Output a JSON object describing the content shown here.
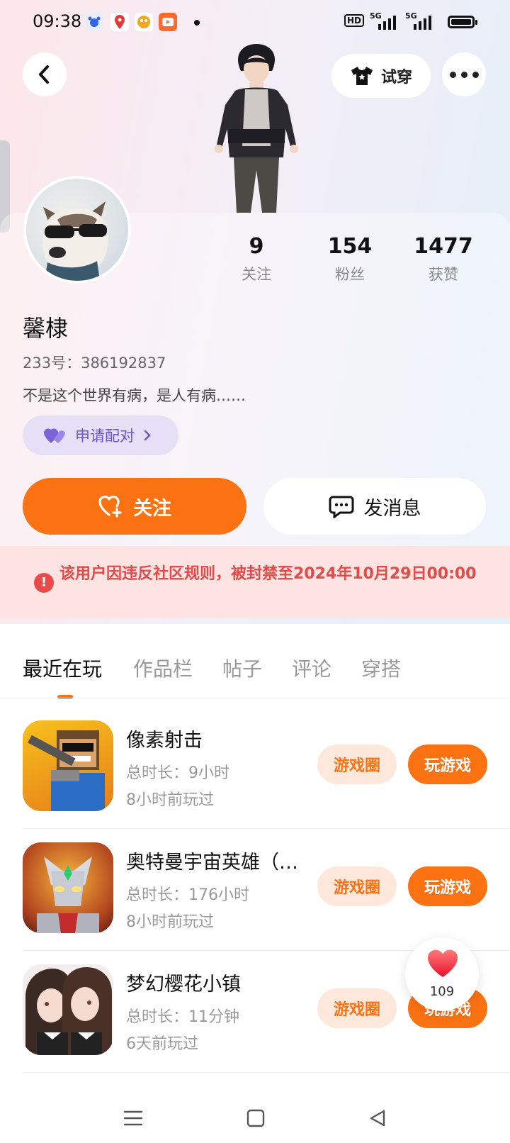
{
  "status_bar": {
    "time": "09:38",
    "hd_label": "HD",
    "sig1_label": "5G",
    "sig2_label": "5G"
  },
  "header": {
    "tryon_label": "试穿"
  },
  "profile": {
    "name": "馨棣",
    "uid": "233号：386192837",
    "bio": "不是这个世界有病，是人有病……",
    "match_label": "申请配对",
    "stats": [
      {
        "value": "9",
        "label": "关注"
      },
      {
        "value": "154",
        "label": "粉丝"
      },
      {
        "value": "1477",
        "label": "获赞"
      }
    ]
  },
  "actions": {
    "follow_label": "关注",
    "message_label": "发消息"
  },
  "ban_notice": "该用户因违反社区规则，被封禁至2024年10月29日00:00",
  "tabs": [
    {
      "label": "最近在玩",
      "active": true
    },
    {
      "label": "作品栏",
      "active": false
    },
    {
      "label": "帖子",
      "active": false
    },
    {
      "label": "评论",
      "active": false
    },
    {
      "label": "穿搭",
      "active": false
    }
  ],
  "games": [
    {
      "title": "像素射击",
      "duration": "总时长：9小时",
      "last_played": "8小时前玩过",
      "circle_label": "游戏圈",
      "play_label": "玩游戏",
      "icon": "pixel-shooter-icon"
    },
    {
      "title": "奥特曼宇宙英雄（…",
      "duration": "总时长：176小时",
      "last_played": "8小时前玩过",
      "circle_label": "游戏圈",
      "play_label": "玩游戏",
      "icon": "ultraman-icon"
    },
    {
      "title": "梦幻樱花小镇",
      "duration": "总时长：11分钟",
      "last_played": "6天前玩过",
      "circle_label": "游戏圈",
      "play_label": "玩游戏",
      "icon": "sakura-town-icon"
    }
  ],
  "like_float": {
    "count": "109"
  },
  "colors": {
    "accent": "#fb7213",
    "ban_text": "#e24b47",
    "match_text": "#6b55c9"
  }
}
